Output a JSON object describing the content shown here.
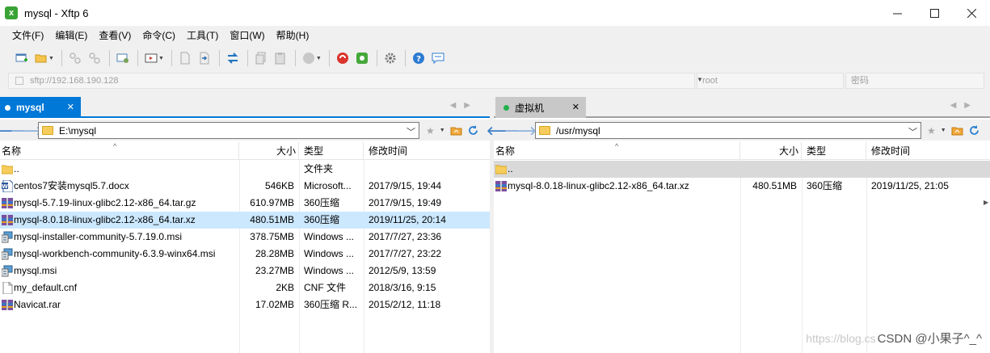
{
  "window": {
    "title": "mysql - Xftp 6",
    "app_icon": "xftp-icon"
  },
  "menu": [
    "文件(F)",
    "编辑(E)",
    "查看(V)",
    "命令(C)",
    "工具(T)",
    "窗口(W)",
    "帮助(H)"
  ],
  "address": {
    "url": "sftp://192.168.190.128",
    "user_placeholder": "root",
    "password_placeholder": "密码"
  },
  "left": {
    "tab_label": "mysql",
    "path": "E:\\mysql",
    "columns": [
      "名称",
      "大小",
      "类型",
      "修改时间"
    ],
    "rows": [
      {
        "name": "..",
        "size": "",
        "type": "文件夹",
        "modified": "",
        "icon": "folder-up"
      },
      {
        "name": "centos7安装mysql5.7.docx",
        "size": "546KB",
        "type": "Microsoft...",
        "modified": "2017/9/15, 19:44",
        "icon": "word"
      },
      {
        "name": "mysql-5.7.19-linux-glibc2.12-x86_64.tar.gz",
        "size": "610.97MB",
        "type": "360压缩",
        "modified": "2017/9/15, 19:49",
        "icon": "archive"
      },
      {
        "name": "mysql-8.0.18-linux-glibc2.12-x86_64.tar.xz",
        "size": "480.51MB",
        "type": "360压缩",
        "modified": "2019/11/25, 20:14",
        "icon": "archive"
      },
      {
        "name": "mysql-installer-community-5.7.19.0.msi",
        "size": "378.75MB",
        "type": "Windows ...",
        "modified": "2017/7/27, 23:36",
        "icon": "msi"
      },
      {
        "name": "mysql-workbench-community-6.3.9-winx64.msi",
        "size": "28.28MB",
        "type": "Windows ...",
        "modified": "2017/7/27, 23:22",
        "icon": "msi"
      },
      {
        "name": "mysql.msi",
        "size": "23.27MB",
        "type": "Windows ...",
        "modified": "2012/5/9, 13:59",
        "icon": "msi"
      },
      {
        "name": "my_default.cnf",
        "size": "2KB",
        "type": "CNF 文件",
        "modified": "2018/3/16, 9:15",
        "icon": "file"
      },
      {
        "name": "Navicat.rar",
        "size": "17.02MB",
        "type": "360压缩 R...",
        "modified": "2015/2/12, 11:18",
        "icon": "archive"
      }
    ],
    "selected_index": 3
  },
  "right": {
    "tab_label": "虚拟机",
    "path": "/usr/mysql",
    "columns": [
      "名称",
      "大小",
      "类型",
      "修改时间"
    ],
    "rows": [
      {
        "name": "..",
        "size": "",
        "type": "",
        "modified": "",
        "icon": "folder-up"
      },
      {
        "name": "mysql-8.0.18-linux-glibc2.12-x86_64.tar.xz",
        "size": "480.51MB",
        "type": "360压缩",
        "modified": "2019/11/25, 21:05",
        "icon": "archive"
      }
    ],
    "highlight_index": 0
  },
  "watermark": {
    "faint": "https://blog.cs",
    "text": "CSDN @小果子^_^"
  },
  "colors": {
    "accent": "#0078d7",
    "selection": "#cce8ff",
    "tab_dot_left": "#ffffff",
    "tab_dot_right": "#22b14c"
  }
}
